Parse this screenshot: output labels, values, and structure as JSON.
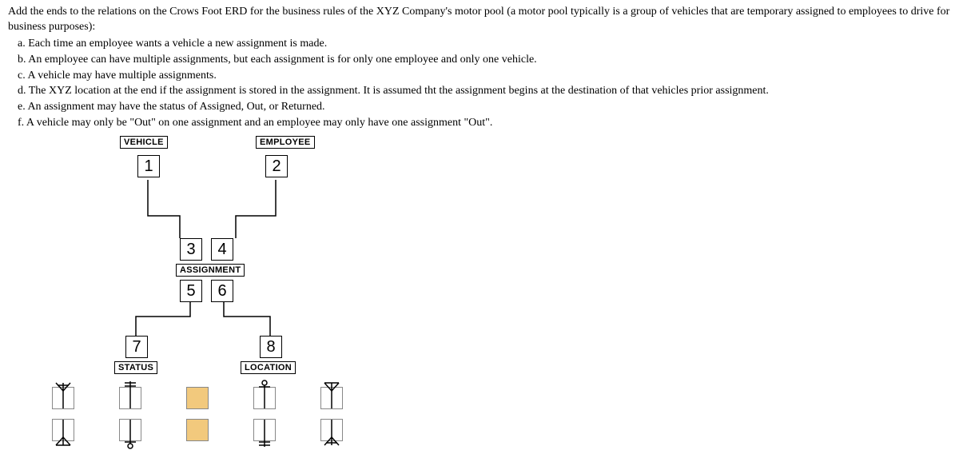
{
  "rules": {
    "intro": "Add the ends to the relations on the Crows Foot ERD for the business rules of the XYZ Company's motor pool (a motor pool typically is a group of vehicles that are temporary assigned to employees to drive for business purposes):",
    "a": "a. Each time an employee wants a vehicle a new assignment is made.",
    "b": "b. An employee can have multiple assignments, but each assignment is for only one employee and only one vehicle.",
    "c": "c. A vehicle may have multiple assignments.",
    "d": "d. The XYZ location at the end if the assignment is stored in the assignment. It is assumed tht the assignment begins at the destination of that vehicles prior assignment.",
    "e": "e. An assignment may have the status of Assigned, Out, or Returned.",
    "f": "f. A vehicle may only be \"Out\" on one assignment and an employee may only have one assignment \"Out\"."
  },
  "entities": {
    "vehicle": "VEHICLE",
    "employee": "EMPLOYEE",
    "assignment": "ASSIGNMENT",
    "status": "STATUS",
    "location": "LOCATION"
  },
  "slots": {
    "n1": "1",
    "n2": "2",
    "n3": "3",
    "n4": "4",
    "n5": "5",
    "n6": "6",
    "n7": "7",
    "n8": "8"
  }
}
